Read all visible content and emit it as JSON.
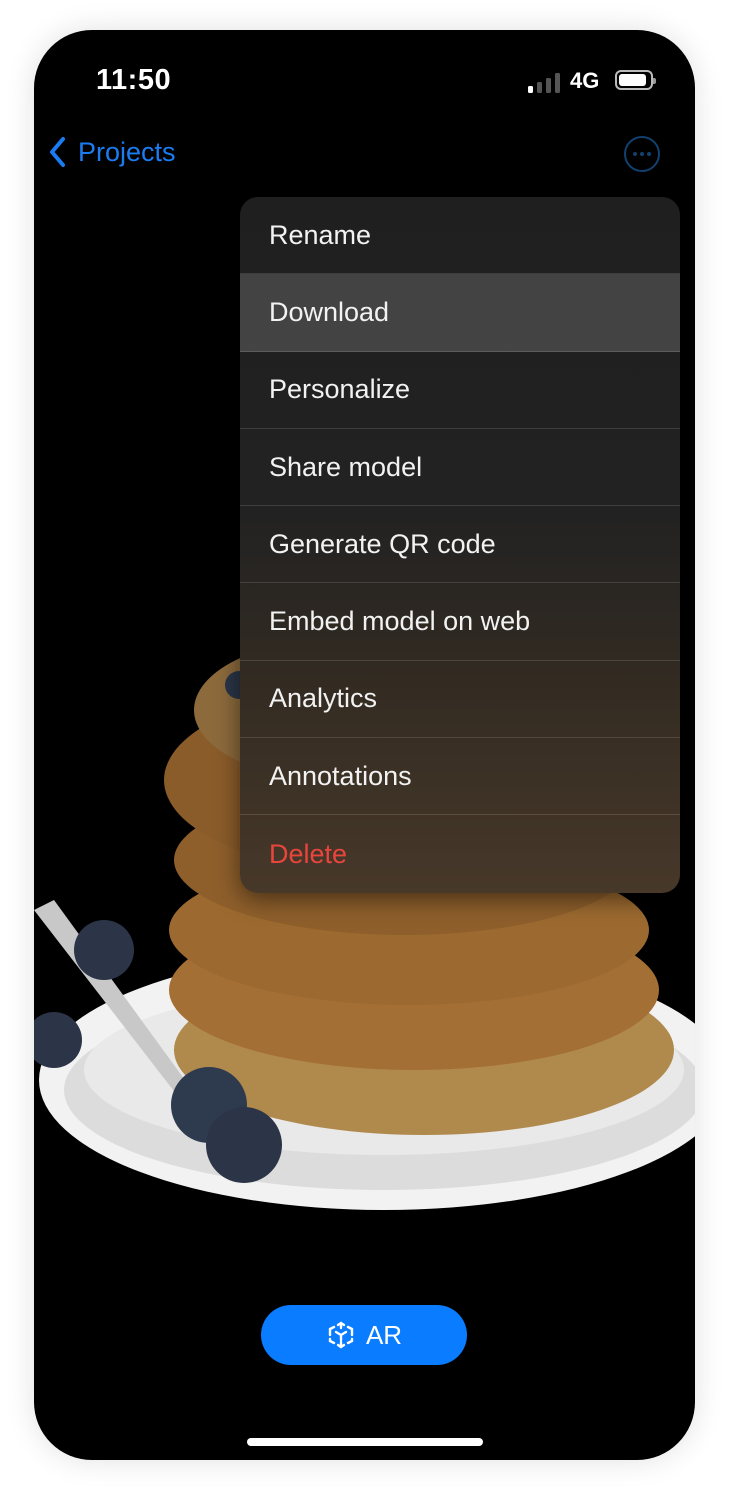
{
  "status_bar": {
    "time": "11:50",
    "network": "4G",
    "signal_bars_active": 1,
    "signal_bars_total": 4,
    "battery_icon": "battery-full-icon"
  },
  "nav": {
    "back_label": "Projects",
    "back_icon": "chevron-left-icon",
    "more_icon": "ellipsis-circle-icon"
  },
  "menu": {
    "items": [
      {
        "label": "Rename"
      },
      {
        "label": "Download",
        "highlighted": true
      },
      {
        "label": "Personalize"
      },
      {
        "label": "Share model"
      },
      {
        "label": "Generate QR code"
      },
      {
        "label": "Embed model on web"
      },
      {
        "label": "Analytics"
      },
      {
        "label": "Annotations"
      },
      {
        "label": "Delete",
        "destructive": true
      }
    ]
  },
  "scene": {
    "subject": "3D model of pancake stack on plate with blueberries and fork"
  },
  "ar_button": {
    "label": "AR",
    "icon": "ar-cube-icon"
  },
  "colors": {
    "accent": "#0a7cff",
    "link": "#1a7cf0",
    "destructive": "#e8453c",
    "background": "#000000"
  }
}
